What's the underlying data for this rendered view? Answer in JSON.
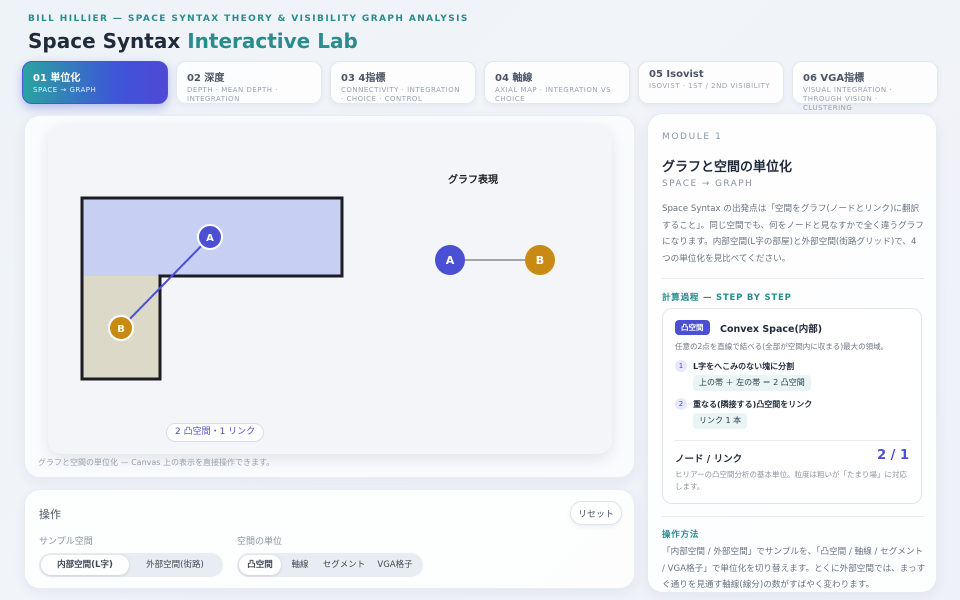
{
  "header": {
    "kicker": "BILL HILLIER — SPACE SYNTAX THEORY & VISIBILITY GRAPH ANALYSIS",
    "title_main": "Space Syntax ",
    "title_accent": "Interactive Lab"
  },
  "tabs": [
    {
      "label": "01 単位化",
      "sub": "SPACE → GRAPH",
      "active": true
    },
    {
      "label": "02 深度",
      "sub": "DEPTH · MEAN DEPTH · INTEGRATION",
      "active": false
    },
    {
      "label": "03 4指標",
      "sub": "CONNECTIVITY · INTEGRATION · CHOICE · CONTROL",
      "active": false
    },
    {
      "label": "04 軸線",
      "sub": "AXIAL MAP · INTEGRATION VS CHOICE",
      "active": false
    },
    {
      "label": "05 Isovist",
      "sub": "ISOVIST · 1ST / 2ND VISIBILITY",
      "active": false
    },
    {
      "label": "06 VGA指標",
      "sub": "VISUAL INTEGRATION · THROUGH VISION · CLUSTERING",
      "active": false
    }
  ],
  "canvas": {
    "graph_title": "グラフ表現",
    "node_a": "A",
    "node_b": "B",
    "count_pill": "2 凸空間・1 リンク",
    "footnote": "グラフと空間の単位化 — Canvas 上の表示を直接操作できます。",
    "colors": {
      "top_fill": "#c7cff2",
      "left_fill": "#ddd9c9",
      "outline": "#1c1c24",
      "node_a": "#4a4fd4",
      "node_b": "#c98a14",
      "link": "#4a4fd4"
    }
  },
  "controls": {
    "title": "操作",
    "reset": "リセット",
    "sample_label": "サンプル空間",
    "sample_options": [
      "内部空間(L字)",
      "外部空間(街路)"
    ],
    "sample_selected": "内部空間(L字)",
    "unit_label": "空間の単位",
    "unit_options": [
      "凸空間",
      "軸線",
      "セグメント",
      "VGA格子"
    ],
    "unit_selected": "凸空間"
  },
  "side": {
    "module": "MODULE 1",
    "title": "グラフと空間の単位化",
    "subtitle": "SPACE → GRAPH",
    "description": "Space Syntax の出発点は「空間をグラフ(ノードとリンク)に翻訳すること」。同じ空間でも、何をノードと見なすかで全く違うグラフになります。内部空間(L字の部屋)と外部空間(街路グリッド)で、4つの単位化を見比べてください。",
    "steps_head": "計算過程 — STEP BY STEP",
    "calc": {
      "badge": "凸空間",
      "title": "Convex Space(内部)",
      "desc": "任意の2点を直線で結べる(全部が空間内に収まる)最大の領域。",
      "step1_num": "1",
      "step1": "L字をへこみのない塊に分割",
      "step1_chip": "上の帯 ＋ 左の帯 ＝ 2 凸空間",
      "step2_num": "2",
      "step2": "重なる(隣接する)凸空間をリンク",
      "step2_chip": "リンク 1 本",
      "nl_label": "ノード / リンク",
      "nl_value": "2 / 1",
      "nl_note": "ヒリアーの凸空間分析の基本単位。粒度は粗いが「たまり場」に対応します。"
    },
    "howto_head": "操作方法",
    "howto": "「内部空間 / 外部空間」でサンプルを、「凸空間 / 軸線 / セグメント / VGA格子」で単位化を切り替えます。とくに外部空間では、まっすぐ通りを見通す軸線(線分)の数がすばやく変わります。"
  }
}
